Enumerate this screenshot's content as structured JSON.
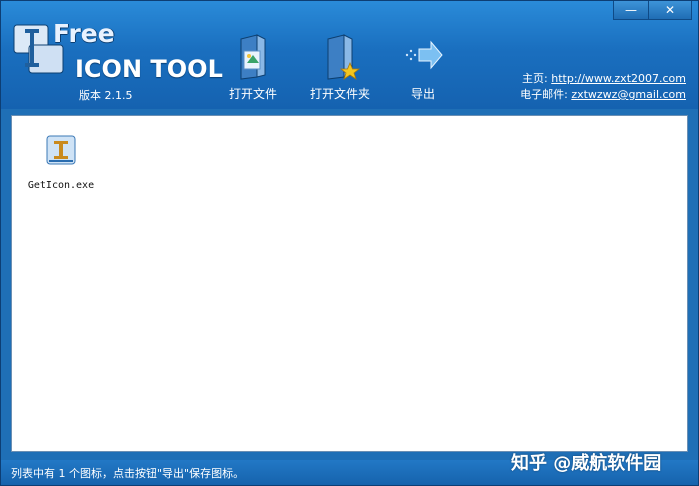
{
  "window": {
    "minimize_label": "—",
    "close_label": "✕"
  },
  "logo": {
    "brand_free": "Free",
    "title": "ICON TOOL",
    "version": "版本 2.1.5"
  },
  "toolbar": {
    "open_file_label": "打开文件",
    "open_folder_label": "打开文件夹",
    "export_label": "导出"
  },
  "links": {
    "homepage_label": "主页:",
    "homepage_value": "http://www.zxt2007.com",
    "email_label": "电子邮件:",
    "email_value": "zxtwzwz@gmail.com"
  },
  "files": [
    {
      "name": "GetIcon.exe"
    }
  ],
  "status": {
    "text": "列表中有 1 个图标，点击按钮\"导出\"保存图标。"
  },
  "watermark": {
    "text": "知乎 @威航软件园"
  },
  "colors": {
    "header": "#1a6fbf",
    "statusbar": "#1a6bb8",
    "content_bg": "#ffffff"
  }
}
